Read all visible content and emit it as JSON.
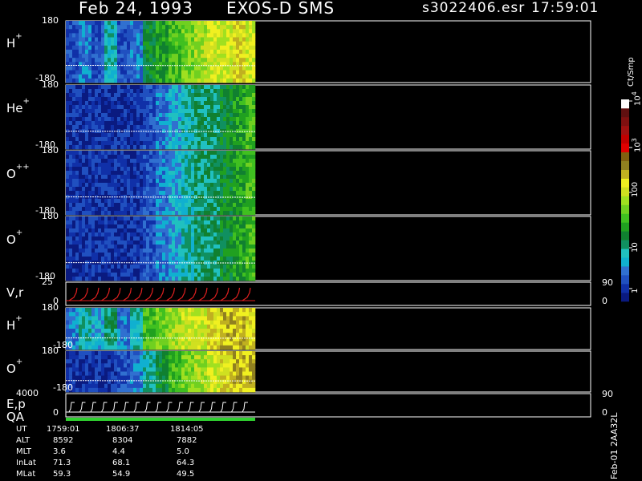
{
  "header": {
    "date": "Feb 24, 1993",
    "instrument": "EXOS-D SMS",
    "file": "s3022406.esr",
    "time": "17:59:01"
  },
  "colorbar": {
    "unit_label": "Ct/Smp",
    "ticks": [
      "1",
      "10",
      "100",
      "10",
      "10"
    ],
    "tick_exponents": [
      "",
      "",
      "",
      "3",
      "4"
    ],
    "colors": [
      "#0a1a80",
      "#1030a8",
      "#2050c0",
      "#3070d0",
      "#10b0d0",
      "#20c0c0",
      "#109060",
      "#108030",
      "#20a020",
      "#40c020",
      "#70d020",
      "#a0e020",
      "#d0e020",
      "#f0f020",
      "#c0b020",
      "#908020",
      "#806010",
      "#e00000",
      "#c00000",
      "#a01010",
      "#801010",
      "#601010",
      "#ffffff"
    ]
  },
  "version": "Feb-01 2AA32L",
  "palette": {
    "background": "#000000",
    "frame": "#ffffff",
    "dir_line": "#ffffff",
    "vr_curve": "#e02020",
    "ep_curve": "#ffffff",
    "qa_bar": "#30d030"
  },
  "chart_data": {
    "type": "heatmap",
    "panels": [
      {
        "name": "H+",
        "species": "H",
        "charge": "+",
        "ymin": "-180",
        "ymax": "180",
        "intensity_profile": [
          2,
          3,
          2,
          5,
          2,
          3,
          7,
          8,
          9,
          10,
          11,
          12,
          12,
          13,
          12
        ],
        "ion_direction": true
      },
      {
        "name": "He+",
        "species": "He",
        "charge": "+",
        "ymin": "-180",
        "ymax": "180",
        "intensity_profile": [
          1,
          1,
          1,
          1,
          1,
          1,
          2,
          3,
          4,
          5,
          6,
          6,
          7,
          8,
          9
        ],
        "ion_direction": true
      },
      {
        "name": "O++",
        "species": "O",
        "charge": "++",
        "ymin": "-180",
        "ymax": "180",
        "intensity_profile": [
          1,
          1,
          1,
          1,
          1,
          1,
          2,
          3,
          4,
          5,
          6,
          6,
          7,
          8,
          9
        ],
        "ion_direction": true
      },
      {
        "name": "O+",
        "species": "O",
        "charge": "+",
        "ymin": "-180",
        "ymax": "180",
        "intensity_profile": [
          1,
          1,
          1,
          1,
          1,
          1,
          2,
          3,
          4,
          5,
          6,
          6,
          7,
          8,
          9
        ],
        "ion_direction": true
      },
      {
        "name": "V,r",
        "species": "V,r",
        "charge": "",
        "ymin": "0",
        "ymax": "25",
        "right_ymin": "0",
        "right_ymax": "90",
        "line_plot": true
      },
      {
        "name": "H+",
        "species": "H",
        "charge": "+",
        "ymin": "-180",
        "ymax": "180",
        "intensity_profile": [
          3,
          5,
          4,
          6,
          3,
          5,
          9,
          10,
          11,
          12,
          12,
          13,
          14,
          14,
          13
        ],
        "ion_direction": true
      },
      {
        "name": "O+",
        "species": "O",
        "charge": "+",
        "ymin": "-180",
        "ymax": "180",
        "intensity_profile": [
          1,
          1,
          1,
          1,
          2,
          3,
          5,
          7,
          9,
          10,
          11,
          12,
          13,
          14,
          14
        ],
        "ion_direction": true
      },
      {
        "name": "E,p",
        "species": "E,p",
        "charge": "",
        "ymin": "0",
        "ymax": "4000",
        "right_ymin": "0",
        "right_ymax": "90",
        "line_plot": true
      }
    ],
    "qa_label": "QA",
    "ephemeris": {
      "rows": [
        {
          "label": "UT",
          "values": [
            "1759:01",
            "1806:37",
            "1814:05"
          ]
        },
        {
          "label": "ALT",
          "values": [
            "8592",
            "8304",
            "7882"
          ]
        },
        {
          "label": "MLT",
          "values": [
            "3.6",
            "4.4",
            "5.0"
          ]
        },
        {
          "label": "InLat",
          "values": [
            "71.3",
            "68.1",
            "64.3"
          ]
        },
        {
          "label": "MLat",
          "values": [
            "59.3",
            "54.9",
            "49.5"
          ]
        }
      ]
    }
  }
}
